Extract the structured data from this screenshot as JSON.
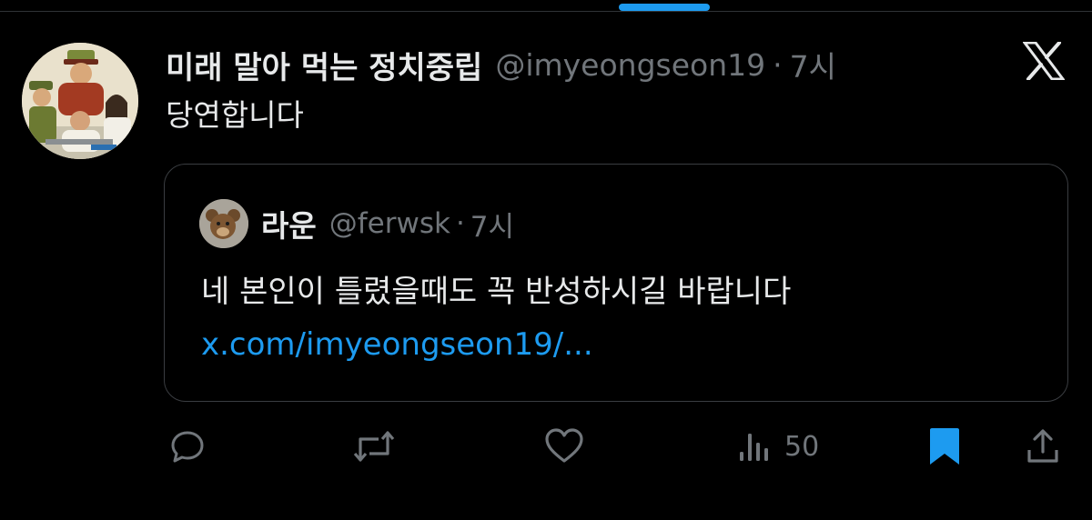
{
  "tweet": {
    "author_name": "미래 말아 먹는 정치중립",
    "author_handle": "@imyeongseon19",
    "separator": "·",
    "time": "7시",
    "text": "당연합니다",
    "icons": {
      "avatar": "illustrated-avatar",
      "logo": "x-logo-icon"
    }
  },
  "quote": {
    "author_name": "라운",
    "author_handle": "@ferwsk",
    "separator": "·",
    "time": "7시",
    "text": "네 본인이 틀렸을때도 꼭 반성하시길 바랍니다",
    "link": "x.com/imyeongseon19/..."
  },
  "actions": {
    "reply": {
      "icon": "reply-icon"
    },
    "retweet": {
      "icon": "retweet-icon"
    },
    "like": {
      "icon": "heart-icon"
    },
    "views": {
      "icon": "views-icon",
      "count": "50"
    },
    "bookmark": {
      "icon": "bookmark-icon",
      "active": true
    },
    "share": {
      "icon": "share-icon"
    }
  },
  "colors": {
    "background": "#000000",
    "text": "#e7e9ea",
    "muted": "#71767b",
    "accent": "#1d9bf0",
    "border": "#3a3d41"
  }
}
